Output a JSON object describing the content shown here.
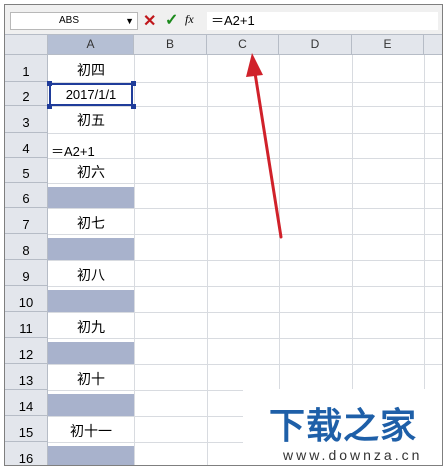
{
  "formula_bar": {
    "name_box": "ABS",
    "cancel_icon": "cancel-x-icon",
    "enter_icon": "checkmark-icon",
    "fx_label": "fx",
    "formula_text": "＝A2+1"
  },
  "columns": [
    "A",
    "B",
    "C",
    "D",
    "E"
  ],
  "rows": [
    "1",
    "2",
    "3",
    "4",
    "5",
    "6",
    "7",
    "8",
    "9",
    "10",
    "11",
    "12",
    "13",
    "14",
    "15",
    "16"
  ],
  "cells_A": {
    "r1": "初四",
    "r2": "2017/1/1",
    "r3": "初五",
    "r4_formula": "＝A2+1",
    "r5": "初六",
    "r7": "初七",
    "r9": "初八",
    "r11": "初九",
    "r13": "初十",
    "r15": "初十一"
  },
  "annotation": {
    "arrow_color": "#d0212a"
  },
  "watermark": {
    "title": "下载之家",
    "url": "www.downza.cn",
    "color": "#1e5fa8"
  }
}
